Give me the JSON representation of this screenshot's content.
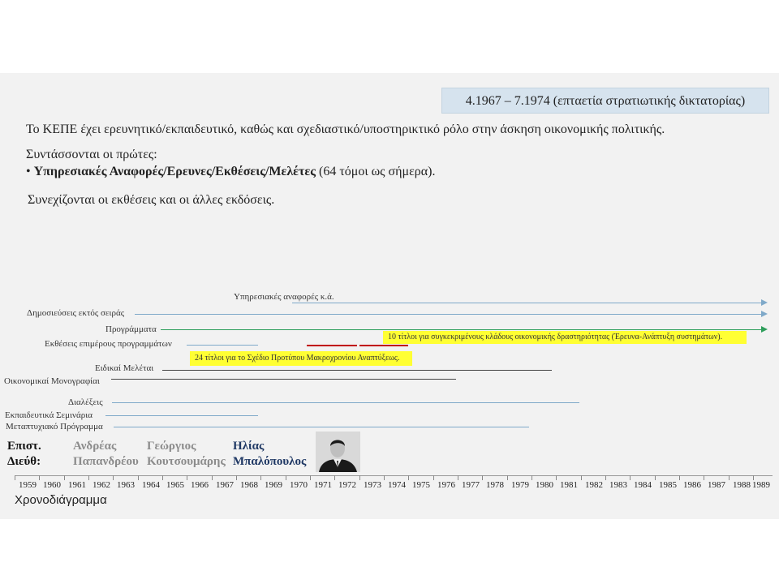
{
  "period": "4.1967 – 7.1974 (επταετία στρατιωτικής δικτατορίας)",
  "intro": "Το ΚΕΠΕ έχει ερευνητικό/εκπαιδευτικό, καθώς και σχεδιαστικό/υποστηρικτικό ρόλο στην άσκηση οικονομικής πολιτικής.",
  "list_intro": "Συντάσσονται οι πρώτες:",
  "bullet_bold": "Υπηρεσιακές Αναφορές/Ερευνες/Εκθέσεις/Μελέτες",
  "bullet_rest": "(64 τόμοι ως σήμερα).",
  "continuation": "Συνεχίζονται οι εκθέσεις και οι άλλες εκδόσεις.",
  "timeline": {
    "rows": [
      {
        "label": "Υπηρεσιακές αναφορές κ.ά."
      },
      {
        "label": "Δημοσιεύσεις εκτός σειράς"
      },
      {
        "label": "Προγράμματα"
      },
      {
        "label": "Εκθέσεις επιμέρους προγραμμάτων"
      },
      {
        "label": "Ειδικαί Μελέται"
      },
      {
        "label": "Οικονομικαί Μονογραφίαι"
      },
      {
        "label": "Διαλέξεις"
      },
      {
        "label": "Εκπαιδευτικά  Σεμινάρια"
      },
      {
        "label": "Μεταπτυχιακό Πρόγραμμα"
      }
    ],
    "note_1": "10 τίτλοι για  συγκεκριμένους κλάδους οικονομικής δραστηριότητας (Έρευνα-Ανάπτυξη συστημάτων).",
    "note_2": "24 τίτλοι για το Σχέδιο Προτύπου Μακροχρονίου Αναπτύξεως.",
    "years": [
      "1959",
      "1960",
      "1961",
      "1962",
      "1963",
      "1964",
      "1965",
      "1966",
      "1967",
      "1968",
      "1969",
      "1970",
      "1971",
      "1972",
      "1973",
      "1974",
      "1975",
      "1976",
      "1977",
      "1978",
      "1979",
      "1980",
      "1981",
      "1982",
      "1983",
      "1984",
      "1985",
      "1986",
      "1987",
      "1988",
      "1989"
    ],
    "axis_label": "Χρονοδιάγραμμα",
    "line_color": "#7fa9c9",
    "highlight_color": "#ffff33",
    "accent_red": "#c00000",
    "accent_green": "#2e9e5b"
  },
  "directors": {
    "label_line1": "Επιστ.",
    "label_line2": "Διεύθ:",
    "d1_first": "Ανδρέας",
    "d1_last": "Παπανδρέου",
    "d2_first": "Γεώργιος",
    "d2_last": "Κουτσουμάρης",
    "d3_first": "Ηλίας",
    "d3_last": "Μπαλόπουλος"
  }
}
